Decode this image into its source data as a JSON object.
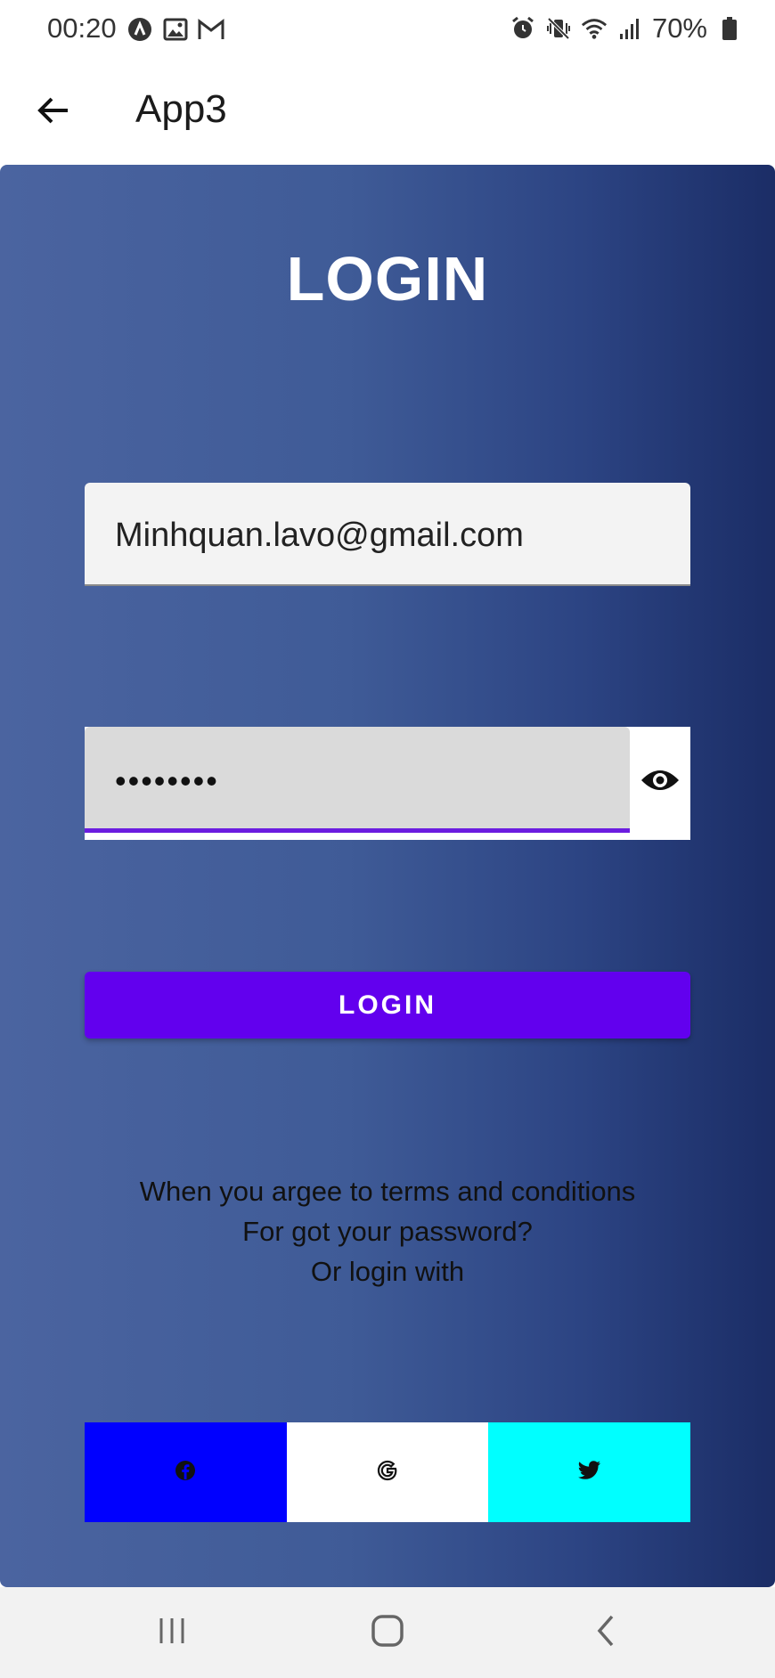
{
  "status_bar": {
    "time": "00:20",
    "battery": "70%",
    "left_icons": [
      "app-icon",
      "image-icon",
      "gmail-icon"
    ],
    "right_icons": [
      "alarm-icon",
      "vibrate-icon",
      "wifi-icon",
      "signal-icon",
      "battery-icon"
    ]
  },
  "app_bar": {
    "title": "App3",
    "back_icon": "arrow-left-icon"
  },
  "login": {
    "heading": "LOGIN",
    "email_value": "Minhquan.lavo@gmail.com",
    "password_value": "••••••••",
    "button_label": "LOGIN",
    "accent_color": "#6200ee"
  },
  "info": {
    "line1": "When you argee to terms and conditions",
    "line2": "For got your password?",
    "line3": "Or login with"
  },
  "social": {
    "facebook_color": "#0000ff",
    "google_color": "#ffffff",
    "twitter_color": "#00ffff"
  },
  "nav": {
    "items": [
      "recents-icon",
      "home-icon",
      "back-icon"
    ]
  }
}
